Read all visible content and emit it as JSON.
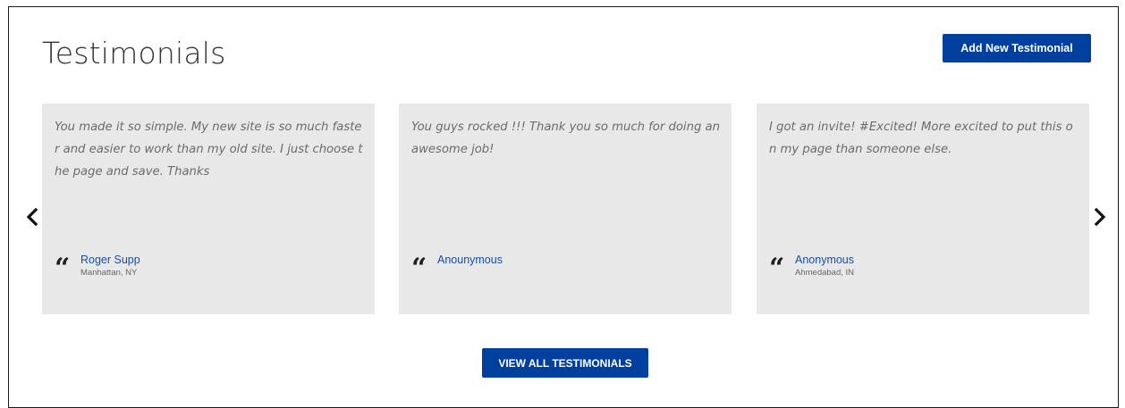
{
  "header": {
    "title": "Testimonials",
    "add_button_label": "Add New Testimonial"
  },
  "carousel": {
    "prev_icon": "chevron-left-icon",
    "next_icon": "chevron-right-icon",
    "cards": [
      {
        "text": "You made it so simple. My new site is so much faster and easier to work than my old site. I just choose the page and save. Thanks",
        "author": "Roger Supp",
        "location": "Manhattan, NY"
      },
      {
        "text": "You guys rocked !!! Thank you so much for doing an awesome job!",
        "author": "Anounymous",
        "location": ""
      },
      {
        "text": "I got an invite! #Excited! More excited to put this on my page than someone else.",
        "author": "Anonymous",
        "location": "Ahmedabad, IN"
      }
    ]
  },
  "footer": {
    "view_all_label": "VIEW ALL TESTIMONIALS"
  },
  "colors": {
    "button": "#003f9e",
    "card_bg": "#e8e8e8",
    "link": "#1a4fa0"
  }
}
